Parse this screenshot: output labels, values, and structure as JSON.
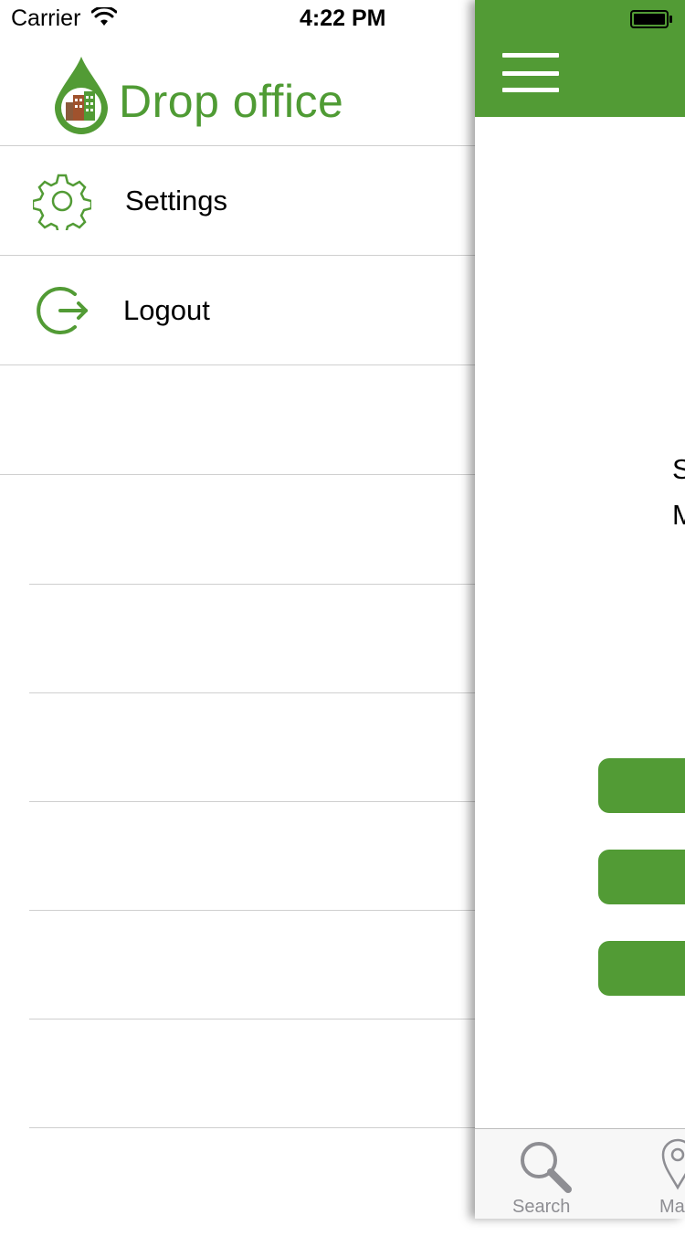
{
  "status_bar": {
    "carrier": "Carrier",
    "time": "4:22 PM"
  },
  "logo": {
    "text": "Drop office"
  },
  "menu": {
    "items": [
      {
        "label": "Settings",
        "icon": "gear-icon"
      },
      {
        "label": "Logout",
        "icon": "logout-icon"
      }
    ]
  },
  "content": {
    "partial_text": [
      "S",
      "M"
    ]
  },
  "tab_bar": {
    "tabs": [
      {
        "label": "Search",
        "icon": "search-icon"
      },
      {
        "label": "Ma",
        "icon": "map-pin-icon"
      }
    ]
  },
  "colors": {
    "brand_green": "#529b35",
    "logo_green": "#4f9b34",
    "tab_inactive": "#8e8e93",
    "divider": "#cfcfcf"
  }
}
